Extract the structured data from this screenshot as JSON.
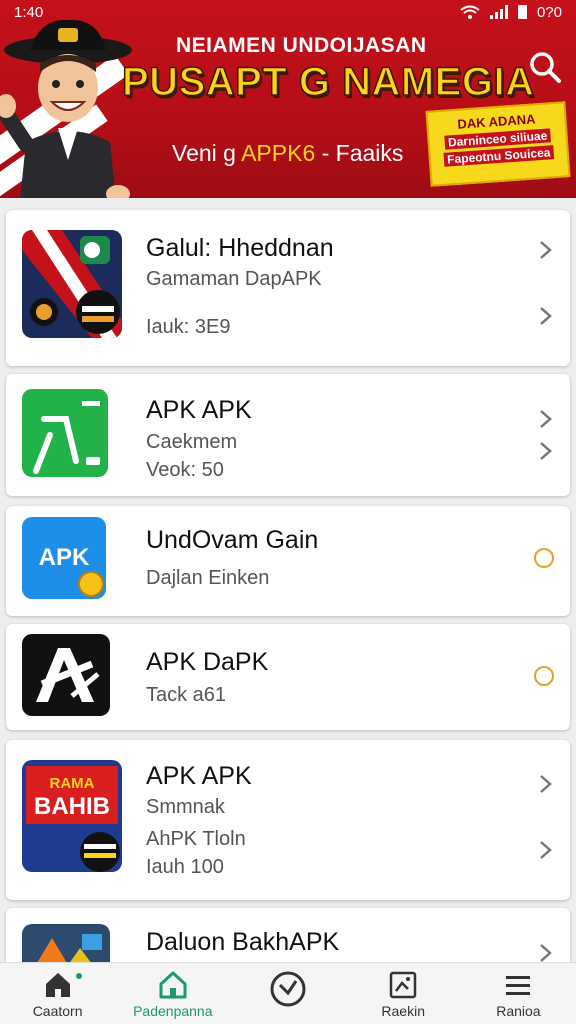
{
  "status": {
    "time": "1:40",
    "battery_text": "0?0"
  },
  "header": {
    "subtitle": "NEIAMEN UNDOIJASAN",
    "title": "PUSAPT G NAMEGIA",
    "tagline_a": "Veni g ",
    "tagline_b": "APPK6",
    "tagline_c": " - Faaiks",
    "promo_line1": "DAK ADANA",
    "promo_line2": "Darninceo siliuae",
    "promo_line3": "Fapeotnu Souicea",
    "search_icon": "search-icon"
  },
  "apps": [
    {
      "title": "Galul: Hheddnan",
      "sub1": "Gamaman DapAPK",
      "sub2": "Iauk: 3E9"
    },
    {
      "title": "APK APK",
      "sub1": "Caekmem",
      "sub2": "Veok: 50"
    },
    {
      "title": "UndOvam Gain",
      "sub1": "Dajlan Einken",
      "icon_text": "APK"
    },
    {
      "title": "APK DaPK",
      "sub1": "Tack a61"
    },
    {
      "title": "APK APK",
      "sub1": "Smmnak",
      "sub2": "AhPK Tloln",
      "sub3": "Iauh 100",
      "icon_text_top": "RAMA",
      "icon_text_mid": "BAHIB"
    },
    {
      "title": "Daluon BakhAPK"
    }
  ],
  "nav": {
    "items": [
      {
        "label": "Caatorn",
        "icon": "home-icon"
      },
      {
        "label": "Padenpanna",
        "icon": "home-outline-icon"
      },
      {
        "label": "",
        "icon": "clock-icon"
      },
      {
        "label": "Raekin",
        "icon": "image-icon"
      },
      {
        "label": "Ranioa",
        "icon": "menu-icon"
      }
    ]
  },
  "colors": {
    "header_red": "#c5111a",
    "title_yellow": "#ffd21a",
    "accent_green": "#1b9a6e",
    "ring_orange": "#e8a02a"
  }
}
